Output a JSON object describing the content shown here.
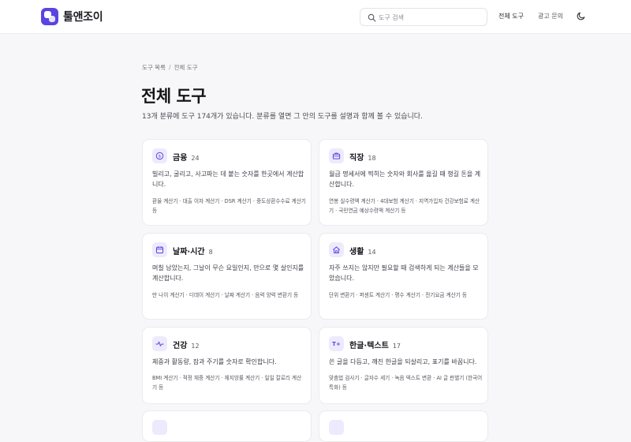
{
  "header": {
    "brand": "툴앤조이",
    "search_placeholder": "도구 검색",
    "nav": [
      "전체 도구",
      "광고 문의"
    ]
  },
  "breadcrumb": [
    "도구 목록",
    "전체 도구"
  ],
  "page_title": "전체 도구",
  "subtitle": "13개 분류에 도구 174개가 있습니다. 분류를 열면 그 안의 도구를 설명과 함께 볼 수 있습니다.",
  "categories": [
    {
      "name": "금융",
      "count": "24",
      "icon": "coin-icon",
      "desc": "빌리고, 굴리고, 사고파는 데 붙는 숫자를 한곳에서 계산합니다.",
      "tools": "환율 계산기 · 대출 이자 계산기 · DSR 계산기 · 중도상환수수료 계산기 등"
    },
    {
      "name": "직장",
      "count": "18",
      "icon": "briefcase-icon",
      "desc": "월급 명세서에 찍히는 숫자와 회사를 옮길 때 챙길 돈을 계산합니다.",
      "tools": "연봉 실수령액 계산기 · 4대보험 계산기 · 지역가입자 건강보험료 계산기 · 국민연금 예상수령액 계산기 등"
    },
    {
      "name": "날짜·시간",
      "count": "8",
      "icon": "calendar-icon",
      "desc": "며칠 남았는지, 그날이 무슨 요일인지, 만으로 몇 살인지를 계산합니다.",
      "tools": "만 나이 계산기 · 디데이 계산기 · 날짜 계산기 · 음력 양력 변환기 등"
    },
    {
      "name": "생활",
      "count": "14",
      "icon": "home-icon",
      "desc": "자주 쓰지는 않지만 필요할 때 검색하게 되는 계산들을 모았습니다.",
      "tools": "단위 변환기 · 퍼센트 계산기 · 평수 계산기 · 전기요금 계산기 등"
    },
    {
      "name": "건강",
      "count": "12",
      "icon": "pulse-icon",
      "desc": "체중과 활동량, 잠과 주기를 숫자로 확인합니다.",
      "tools": "BMI 계산기 · 적정 체중 계산기 · 체지방률 계산기 · 일일 칼로리 계산기 등"
    },
    {
      "name": "한글·텍스트",
      "count": "17",
      "icon": "text-size-icon",
      "desc": "쓴 글을 다듬고, 깨진 한글을 되살리고, 표기를 바꿉니다.",
      "tools": "맞춤법 검사기 · 글자수 세기 · 녹음 텍스트 변환 · AI 글 판별기 (한국어 특화) 등"
    }
  ],
  "colors": {
    "accent": "#5b45e0",
    "icon_bg": "#eeeafd",
    "page_bg": "#f7f7f9"
  }
}
